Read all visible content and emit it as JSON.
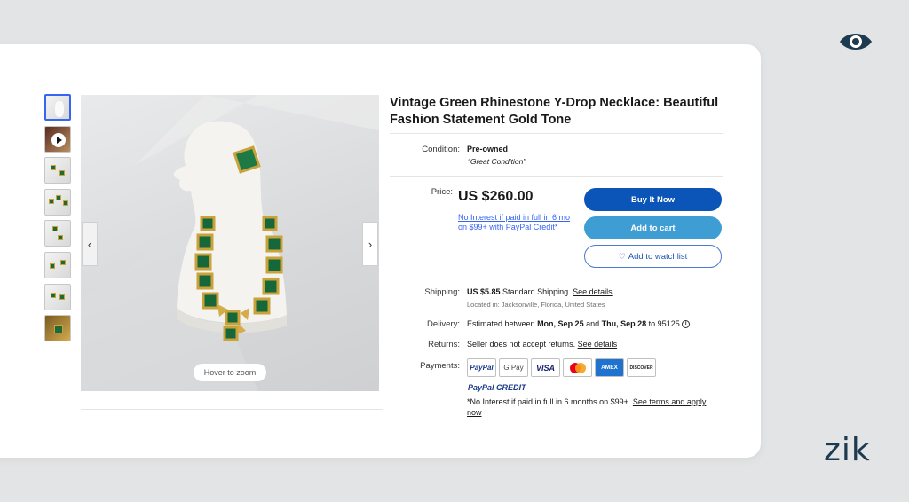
{
  "brand": {
    "wordmark": "zik"
  },
  "gallery": {
    "thumbnail_count": 8,
    "zoom_hint": "Hover to zoom"
  },
  "listing": {
    "title": "Vintage Green Rhinestone Y-Drop Necklace: Beautiful Fashion Statement Gold Tone",
    "condition": {
      "label": "Condition:",
      "value": "Pre-owned",
      "note": "“Great Condition”"
    },
    "price": {
      "label": "Price:",
      "value": "US $260.00",
      "financing": "No Interest if paid in full in 6 mo on $99+ with PayPal Credit*"
    },
    "buttons": {
      "buy_now": "Buy It Now",
      "add_to_cart": "Add to cart",
      "watchlist": "Add to watchlist"
    },
    "shipping": {
      "label": "Shipping:",
      "cost": "US $5.85",
      "method": "Standard Shipping.",
      "details_link": "See details",
      "location": "Located in: Jacksonville, Florida, United States"
    },
    "delivery": {
      "label": "Delivery:",
      "prefix": "Estimated between",
      "start": "Mon, Sep 25",
      "and": "and",
      "end": "Thu, Sep 28",
      "to": "to 95125"
    },
    "returns": {
      "label": "Returns:",
      "text": "Seller does not accept returns.",
      "details_link": "See details"
    },
    "payments": {
      "label": "Payments:",
      "methods": [
        "PayPal",
        "G Pay",
        "VISA",
        "Mastercard",
        "AMEX",
        "DISCOVER"
      ],
      "paypal_credit": "PayPal CREDIT",
      "note": "*No Interest if paid in full in 6 months on $99+.",
      "terms_link": "See terms and apply now"
    }
  },
  "colors": {
    "buy_now": "#0b55b8",
    "add_to_cart": "#3e9ed4",
    "link": "#3665f3",
    "brand_dark": "#1e3a4e"
  }
}
